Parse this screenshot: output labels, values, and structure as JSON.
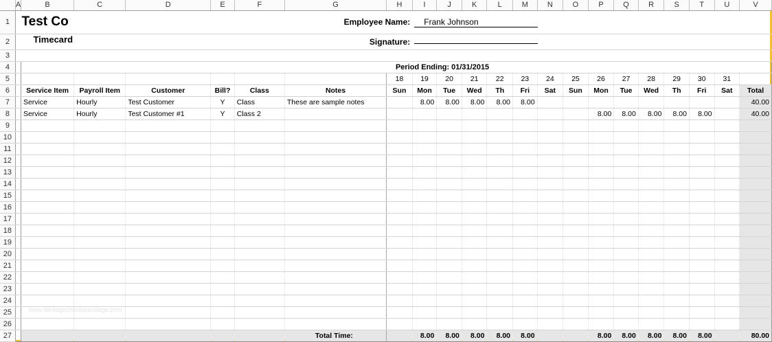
{
  "columns": [
    "A",
    "B",
    "C",
    "D",
    "E",
    "F",
    "G",
    "H",
    "I",
    "J",
    "K",
    "L",
    "M",
    "N",
    "O",
    "P",
    "Q",
    "R",
    "S",
    "T",
    "U",
    "V"
  ],
  "rows": [
    "1",
    "2",
    "3",
    "4",
    "5",
    "6",
    "7",
    "8",
    "9",
    "10",
    "11",
    "12",
    "13",
    "14",
    "15",
    "16",
    "17",
    "18",
    "19",
    "20",
    "21",
    "22",
    "23",
    "24",
    "25",
    "26",
    "27"
  ],
  "company": "Test Co",
  "subtitle": "Timecard",
  "employee_label": "Employee Name:",
  "employee_name": "Frank Johnson",
  "signature_label": "Signature:",
  "period": {
    "label": "Period Ending:",
    "value": "01/31/2015"
  },
  "dates": [
    "18",
    "19",
    "20",
    "21",
    "22",
    "23",
    "24",
    "25",
    "26",
    "27",
    "28",
    "29",
    "30",
    "31"
  ],
  "headers": {
    "service_item": "Service Item",
    "payroll_item": "Payroll Item",
    "customer": "Customer",
    "bill": "Bill?",
    "class": "Class",
    "notes": "Notes",
    "days": [
      "Sun",
      "Mon",
      "Tue",
      "Wed",
      "Th",
      "Fri",
      "Sat",
      "Sun",
      "Mon",
      "Tue",
      "Wed",
      "Th",
      "Fri",
      "Sat"
    ],
    "total": "Total"
  },
  "entries": [
    {
      "service": "Service",
      "payroll": "Hourly",
      "customer": "Test Customer",
      "bill": "Y",
      "class": "Class",
      "notes": "These are sample notes",
      "hours": [
        "",
        "8.00",
        "8.00",
        "8.00",
        "8.00",
        "8.00",
        "",
        "",
        "",
        "",
        "",
        "",
        "",
        ""
      ],
      "total": "40.00"
    },
    {
      "service": "Service",
      "payroll": "Hourly",
      "customer": "Test Customer #1",
      "bill": "Y",
      "class": "Class 2",
      "notes": "",
      "hours": [
        "",
        "",
        "",
        "",
        "",
        "",
        "",
        "",
        "8.00",
        "8.00",
        "8.00",
        "8.00",
        "8.00",
        ""
      ],
      "total": "40.00"
    }
  ],
  "totals": {
    "label": "Total Time:",
    "days": [
      "",
      "8.00",
      "8.00",
      "8.00",
      "8.00",
      "8.00",
      "",
      "",
      "8.00",
      "8.00",
      "8.00",
      "8.00",
      "8.00",
      ""
    ],
    "grand": "80.00"
  },
  "watermark": "www.heritagechristiancollege.com"
}
